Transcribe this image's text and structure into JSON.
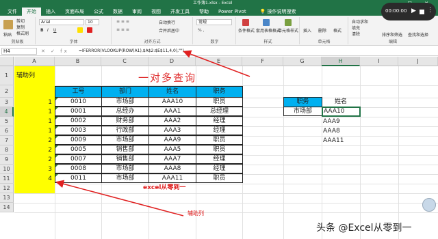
{
  "window": {
    "title": "工作簿1.xlsx - Excel",
    "controls": "— ☐ ✕"
  },
  "ribbon_tabs": [
    "文件",
    "开始",
    "插入",
    "页面布局",
    "公式",
    "数据",
    "审阅",
    "视图",
    "开发工具",
    "帮助",
    "Power Pivot"
  ],
  "tell_me": "操作说明搜索",
  "ribbon": {
    "paste": "粘贴",
    "cut": "剪切",
    "copy": "复制",
    "format_painter": "格式刷",
    "font_name": "Arial",
    "font_size": "10",
    "wrap_text": "自动换行",
    "merge_center": "合并后居中",
    "number_format": "常规",
    "conditional_format": "条件格式",
    "format_as_table": "套用表格格式",
    "cell_styles": "单元格样式",
    "insert": "插入",
    "delete": "删除",
    "format": "格式",
    "autosum": "自动求和",
    "fill": "填充",
    "clear": "清除",
    "sort_filter": "排序和筛选",
    "find_select": "查找和选择",
    "groups": [
      "剪贴板",
      "字体",
      "对齐方式",
      "数字",
      "样式",
      "单元格",
      "编辑"
    ]
  },
  "recorder": {
    "time": "00:00:00",
    "play": "▶",
    "more": "⋮"
  },
  "formula_bar": {
    "name_box": "H4",
    "icons": "✕ ✓ fx",
    "formula": "=IFERROR(VLOOKUP(ROW(A1),$A$2:$E$11,4,0),\"\")"
  },
  "columns": [
    "A",
    "B",
    "C",
    "D",
    "E",
    "F",
    "G",
    "H",
    "I",
    "J"
  ],
  "rows": [
    "1",
    "2",
    "3",
    "4",
    "5",
    "6",
    "7",
    "8",
    "9",
    "10",
    "11",
    "12",
    "13",
    "14"
  ],
  "aux_header": "辅助列",
  "title": "一对多查询",
  "table": {
    "headers": [
      "工号",
      "部门",
      "姓名",
      "职务"
    ],
    "aux_values": [
      "1",
      "1",
      "1",
      "1",
      "2",
      "2",
      "2",
      "3",
      "4"
    ],
    "rows": [
      [
        "0010",
        "市场部",
        "AAA10",
        "职员"
      ],
      [
        "0001",
        "总经办",
        "AAA1",
        "总经理"
      ],
      [
        "0002",
        "财务部",
        "AAA2",
        "经理"
      ],
      [
        "0003",
        "行政部",
        "AAA3",
        "经理"
      ],
      [
        "0009",
        "市场部",
        "AAA9",
        "职员"
      ],
      [
        "0005",
        "销售部",
        "AAA5",
        "职员"
      ],
      [
        "0007",
        "销售部",
        "AAA7",
        "经理"
      ],
      [
        "0008",
        "市场部",
        "AAA8",
        "经理"
      ],
      [
        "0011",
        "市场部",
        "AAA11",
        "职员"
      ]
    ]
  },
  "lookup": {
    "label": "职务",
    "criteria": "市场部",
    "result_header": "姓名",
    "results": [
      "AAA10",
      "AAA9",
      "AAA8",
      "AAA11"
    ]
  },
  "annotations": {
    "credit": "excel从零到一",
    "aux_note": "辅助列"
  },
  "watermark": "头条 @Excel从零到一",
  "colors": {
    "excel_green": "#217346",
    "header_fill": "#00b0f0",
    "aux_fill": "#ffff00",
    "accent_red": "#e03030"
  }
}
